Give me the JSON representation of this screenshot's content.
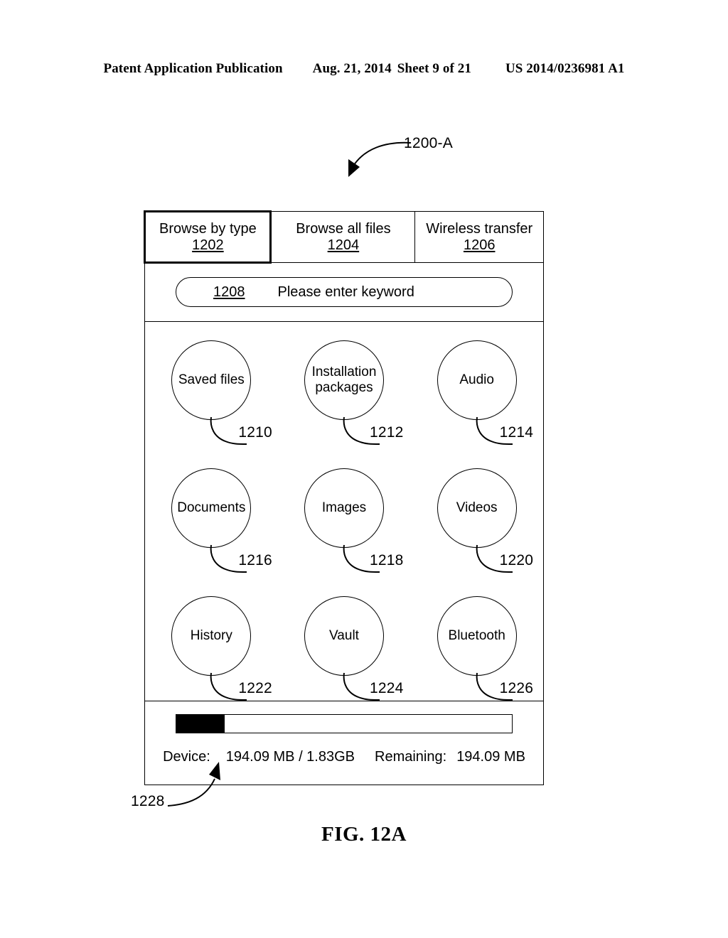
{
  "header": {
    "publication": "Patent Application Publication",
    "date": "Aug. 21, 2014",
    "sheet": "Sheet 9 of 21",
    "patent_number": "US 2014/0236981 A1"
  },
  "figure": {
    "caption": "FIG. 12A",
    "screen_callout": "1200-A",
    "status_callout": "1228"
  },
  "tabs": [
    {
      "label": "Browse by type",
      "ref": "1202",
      "active": true
    },
    {
      "label": "Browse all files",
      "ref": "1204",
      "active": false
    },
    {
      "label": "Wireless transfer",
      "ref": "1206",
      "active": false
    }
  ],
  "search": {
    "ref": "1208",
    "placeholder": "Please enter keyword",
    "value": ""
  },
  "categories": [
    {
      "label": "Saved files",
      "ref": "1210"
    },
    {
      "label": "Installation packages",
      "ref": "1212"
    },
    {
      "label": "Audio",
      "ref": "1214"
    },
    {
      "label": "Documents",
      "ref": "1216"
    },
    {
      "label": "Images",
      "ref": "1218"
    },
    {
      "label": "Videos",
      "ref": "1220"
    },
    {
      "label": "History",
      "ref": "1222"
    },
    {
      "label": "Vault",
      "ref": "1224"
    },
    {
      "label": "Bluetooth",
      "ref": "1226"
    }
  ],
  "status": {
    "progress_percent": 14.5,
    "device_label": "Device:",
    "usage": "194.09 MB / 1.83GB",
    "remaining_label": "Remaining:",
    "remaining_value": "194.09 MB"
  },
  "colors": {
    "ink": "#000000",
    "paper": "#ffffff",
    "progress_fill": "#000000"
  }
}
